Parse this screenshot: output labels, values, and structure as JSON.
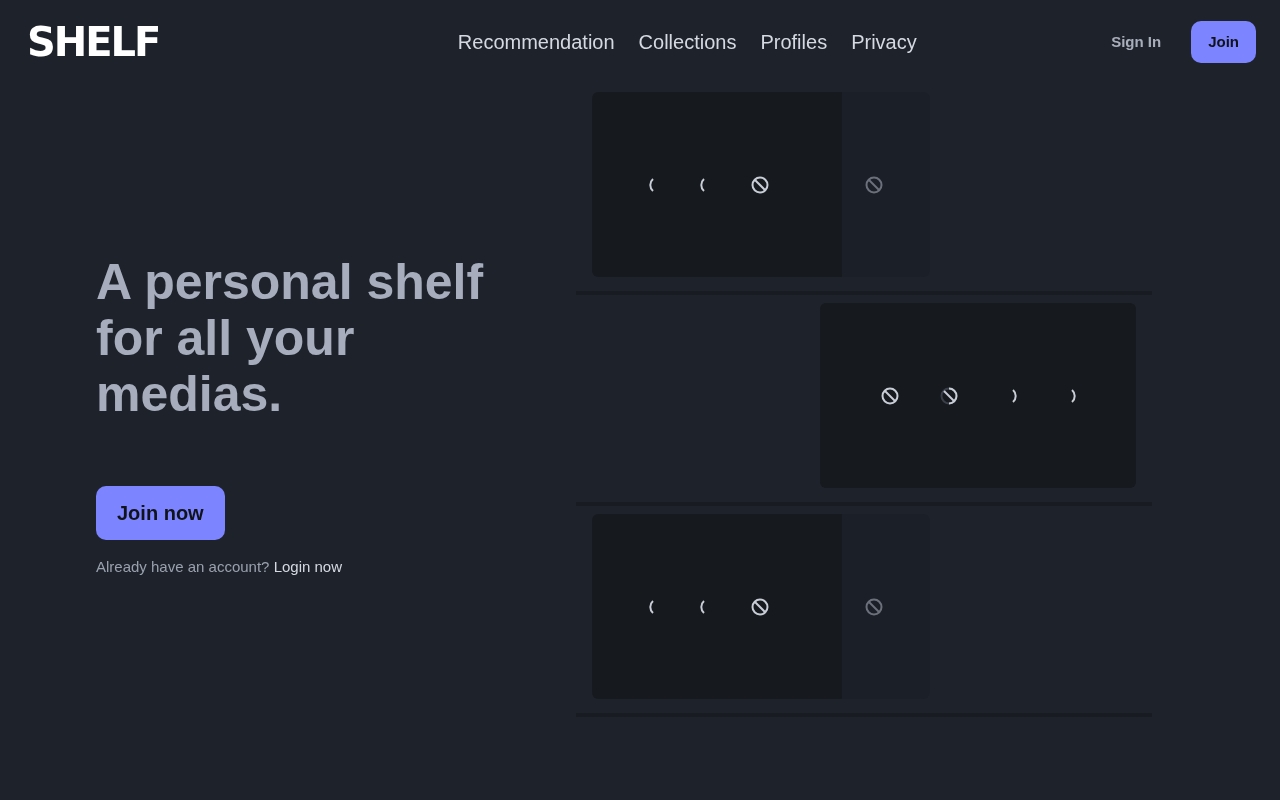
{
  "logo": "SHELF",
  "nav": [
    {
      "label": "Recommendation"
    },
    {
      "label": "Collections"
    },
    {
      "label": "Profiles"
    },
    {
      "label": "Privacy"
    }
  ],
  "sign_in": "Sign In",
  "join": "Join",
  "hero": {
    "title": "A personal shelf for all your medias.",
    "cta": "Join now",
    "login_prompt": "Already have an account?",
    "login_link": "Login now"
  },
  "shelves": [
    {
      "kind": "left"
    },
    {
      "kind": "right"
    },
    {
      "kind": "left"
    }
  ]
}
